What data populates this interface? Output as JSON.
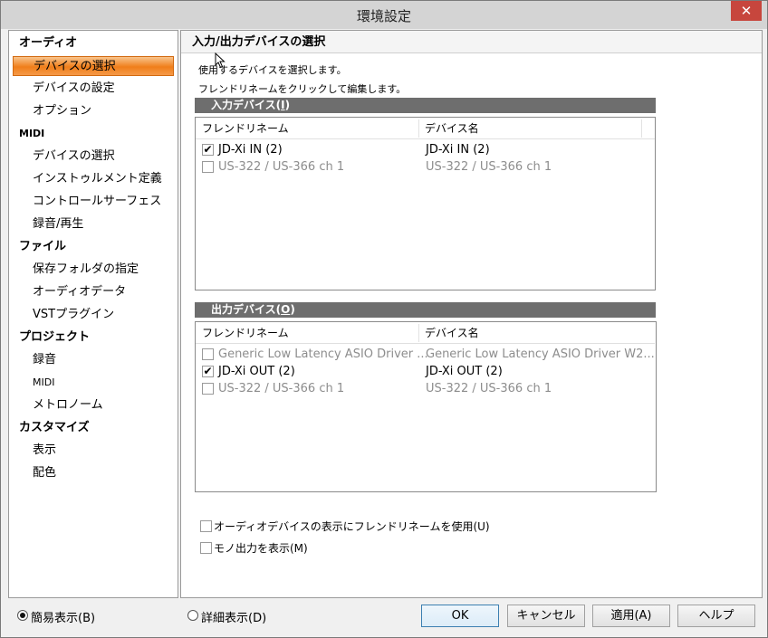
{
  "window": {
    "title": "環境設定",
    "close_label": "✕"
  },
  "sidebar": {
    "items": [
      {
        "label": "オーディオ",
        "kind": "cat"
      },
      {
        "label": "デバイスの選択",
        "kind": "sub",
        "selected": true
      },
      {
        "label": "デバイスの設定",
        "kind": "sub"
      },
      {
        "label": "オプション",
        "kind": "sub"
      },
      {
        "label": "MIDI",
        "kind": "cat"
      },
      {
        "label": "デバイスの選択",
        "kind": "sub"
      },
      {
        "label": "インストゥルメント定義",
        "kind": "sub"
      },
      {
        "label": "コントロールサーフェス",
        "kind": "sub"
      },
      {
        "label": "録音/再生",
        "kind": "sub"
      },
      {
        "label": "ファイル",
        "kind": "cat"
      },
      {
        "label": "保存フォルダの指定",
        "kind": "sub"
      },
      {
        "label": "オーディオデータ",
        "kind": "sub"
      },
      {
        "label": "VSTプラグイン",
        "kind": "sub"
      },
      {
        "label": "プロジェクト",
        "kind": "cat"
      },
      {
        "label": "録音",
        "kind": "sub"
      },
      {
        "label": "MIDI",
        "kind": "sub"
      },
      {
        "label": "メトロノーム",
        "kind": "sub"
      },
      {
        "label": "カスタマイズ",
        "kind": "cat"
      },
      {
        "label": "表示",
        "kind": "sub"
      },
      {
        "label": "配色",
        "kind": "sub"
      }
    ]
  },
  "main": {
    "header": "入力/出力デバイスの選択",
    "desc1": "使用するデバイスを選択します。",
    "desc2": "フレンドリネームをクリックして編集します。",
    "input_section": {
      "title": "入力デバイス(",
      "accel": "I",
      "title_end": ")",
      "col_friendly": "フレンドリネーム",
      "col_device": "デバイス名",
      "rows": [
        {
          "checked": true,
          "friendly": "JD-Xi IN (2)",
          "device": "JD-Xi IN (2)",
          "disabled": false
        },
        {
          "checked": false,
          "friendly": "US-322 / US-366 ch 1",
          "device": "US-322 / US-366 ch 1",
          "disabled": true
        }
      ]
    },
    "output_section": {
      "title": "出力デバイス(",
      "accel": "O",
      "title_end": ")",
      "col_friendly": "フレンドリネーム",
      "col_device": "デバイス名",
      "rows": [
        {
          "checked": false,
          "friendly": "Generic Low Latency ASIO Driver ...",
          "device": "Generic Low Latency ASIO Driver W2...",
          "disabled": true
        },
        {
          "checked": true,
          "friendly": "JD-Xi OUT (2)",
          "device": "JD-Xi OUT (2)",
          "disabled": false
        },
        {
          "checked": false,
          "friendly": "US-322 / US-366 ch 1",
          "device": "US-322 / US-366 ch 1",
          "disabled": true
        }
      ]
    },
    "option_friendly": "オーディオデバイスの表示にフレンドリネームを使用(U)",
    "option_mono": "モノ出力を表示(M)"
  },
  "footer": {
    "simple_view": "簡易表示(B)",
    "detail_view": "詳細表示(D)",
    "ok": "OK",
    "cancel": "キャンセル",
    "apply": "適用(A)",
    "help": "ヘルプ"
  },
  "colors": {
    "selected_accent": "#f07e1a",
    "section_bar": "#6e6e6e"
  }
}
